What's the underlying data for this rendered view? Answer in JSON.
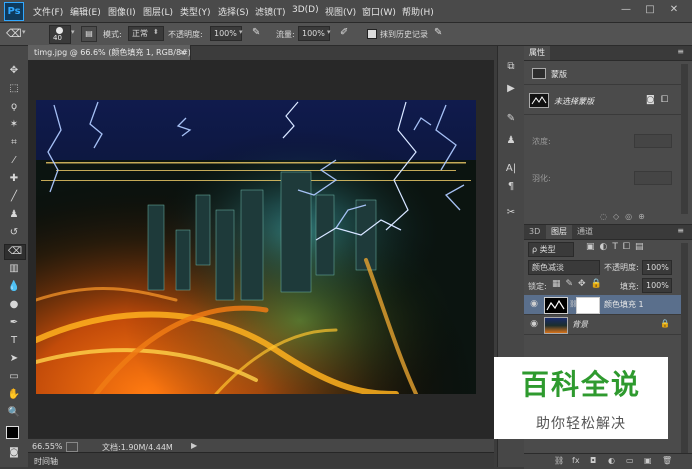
{
  "app": {
    "logo": "Ps",
    "menu": [
      "文件(F)",
      "编辑(E)",
      "图像(I)",
      "图层(L)",
      "类型(Y)",
      "选择(S)",
      "滤镜(T)",
      "3D(D)",
      "视图(V)",
      "窗口(W)",
      "帮助(H)"
    ],
    "window_controls": [
      "—",
      "□",
      "✕"
    ]
  },
  "options": {
    "brush_size": "40",
    "mode_label": "模式:",
    "mode_value": "正常",
    "opacity_label": "不透明度:",
    "opacity_value": "100%",
    "flow_label": "流量:",
    "flow_value": "100%",
    "history_label": "抹到历史记录"
  },
  "document": {
    "tab_title": "timg.jpg @ 66.6% (颜色填充 1, RGB/8#) *",
    "zoom": "66.55%",
    "doc_info": "文档:1.90M/4.44M",
    "timeline_label": "时间轴"
  },
  "properties": {
    "tab": "属性",
    "section": "蒙版",
    "mask_label": "未选择蒙版",
    "density_label": "浓度:",
    "feather_label": "羽化:"
  },
  "layers": {
    "tabs": [
      "3D",
      "图层",
      "通道"
    ],
    "kind_label": "ρ 类型",
    "blend_mode": "颜色减淡",
    "opacity_label": "不透明度:",
    "opacity_value": "100%",
    "lock_label": "锁定:",
    "fill_label": "填充:",
    "fill_value": "100%",
    "items": [
      {
        "name": "颜色填充 1"
      },
      {
        "name": "背景"
      }
    ],
    "footer_icons": [
      "⛓",
      "fx",
      "◘",
      "◐",
      "▭",
      "▣",
      "🗑"
    ]
  },
  "watermark": {
    "title": "百科全说",
    "subtitle": "助你轻松解决"
  },
  "colors": {
    "accent": "#31a8ff",
    "panel": "#4b4b4b",
    "selected_layer": "#5a6f8c",
    "watermark_green": "#2e9a2e"
  }
}
